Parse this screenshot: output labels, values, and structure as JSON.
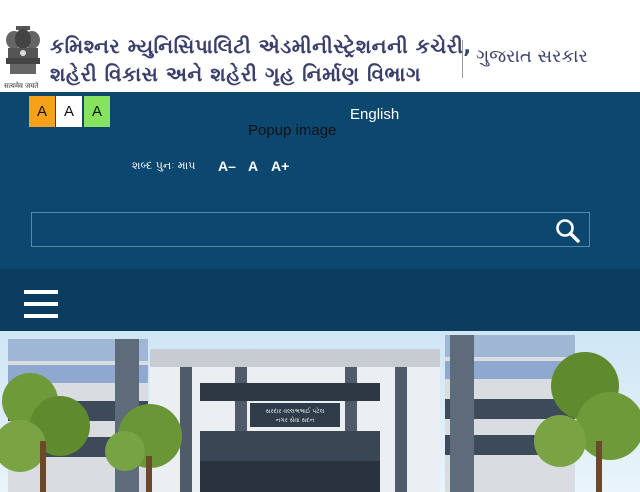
{
  "header": {
    "title_line1": "કમિશ્નર મ્યુનિસિપાલિટી એડમીનીસ્ટ્રેશનની કચેરી,",
    "title_line2": "શહેરી વિકાસ અને શહેરી ગૃહ નિર્માણ વિભાગ",
    "gov_name": "ગુજરાત સરકાર",
    "emblem_motto": "सत्यमेव जयते"
  },
  "accessibility": {
    "contrast_buttons": [
      "A",
      "A",
      "A"
    ],
    "language_link": "English",
    "popup_alt": "Popup image",
    "font_size_label": "શબ્દ પુનઃ માપ",
    "font_decrease": "A–",
    "font_reset": "A",
    "font_increase": "A+"
  },
  "search": {
    "value": "",
    "placeholder": ""
  },
  "hero": {
    "building_sign_line1": "સરદાર વલ્લભભાઈ પટેલ",
    "building_sign_line2": "નગર સેવા સદન"
  },
  "colors": {
    "header_bg": "#ffffff",
    "title_text": "#3a3f6b",
    "top_band": "#0c4770",
    "nav_band": "#0b3d60",
    "contrast_orange": "#f7a11a",
    "contrast_white": "#ffffff",
    "contrast_green": "#86e35b"
  },
  "icons": {
    "emblem": "national-emblem-icon",
    "search": "search-icon",
    "menu": "hamburger-menu-icon"
  }
}
